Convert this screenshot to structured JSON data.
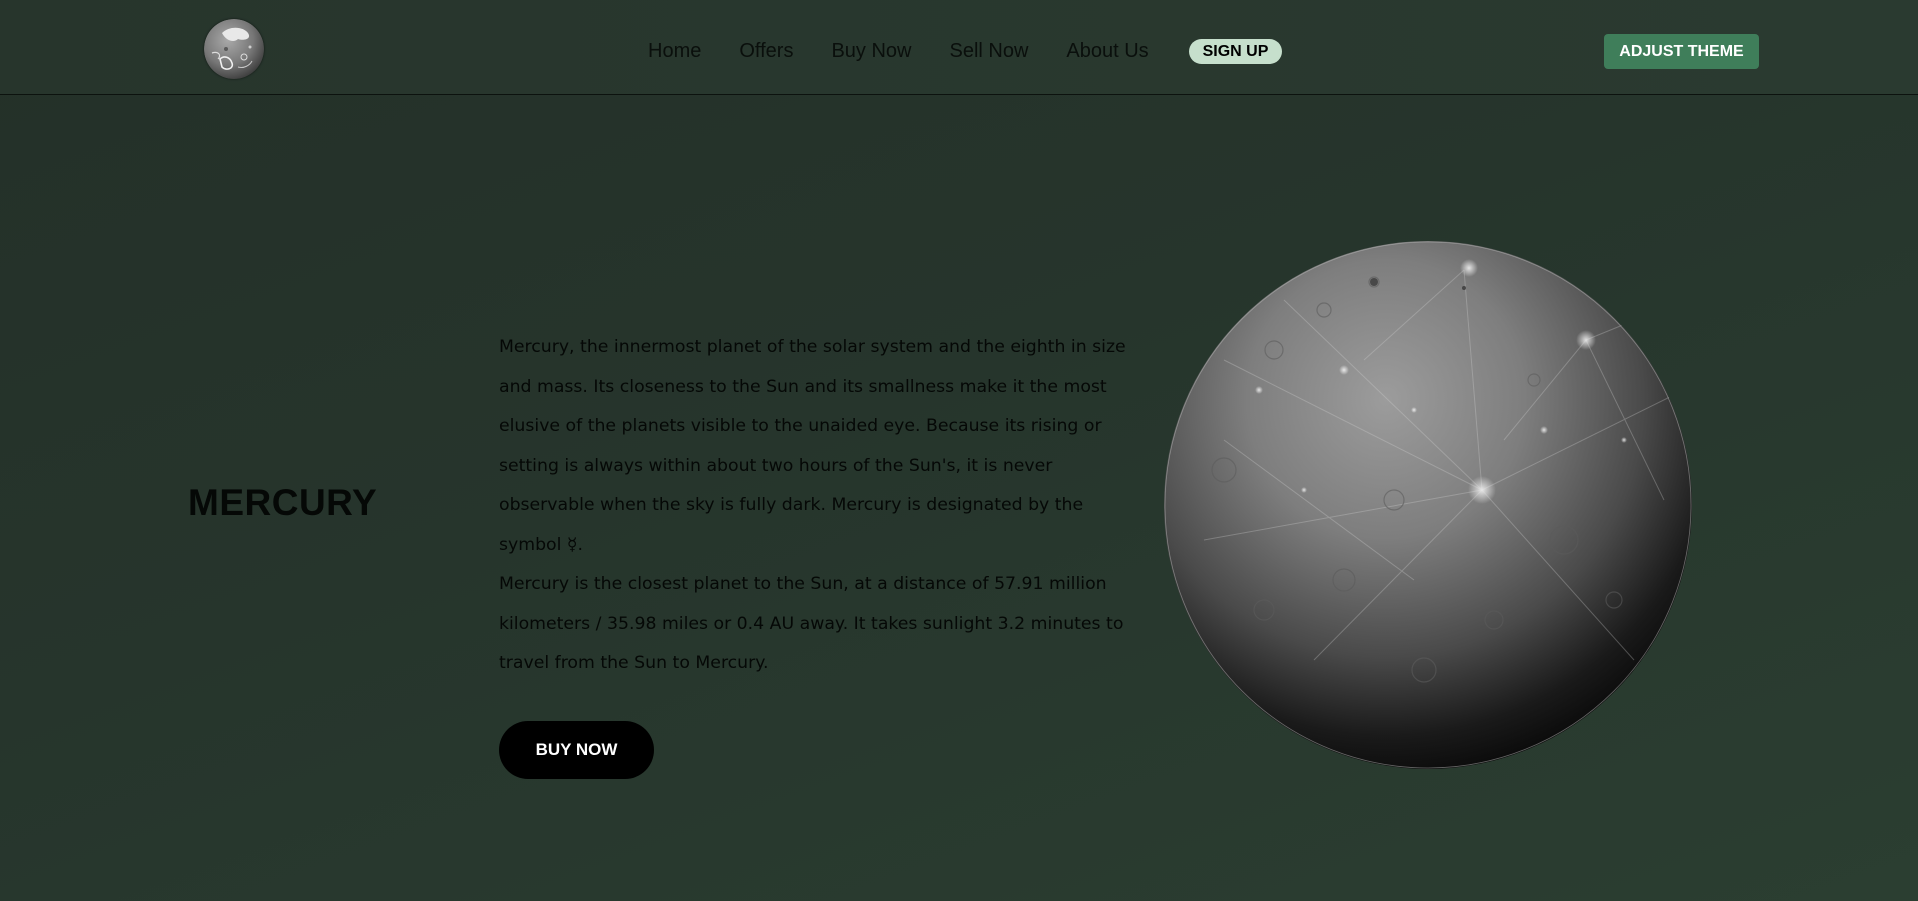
{
  "header": {
    "logo_icon": "planet-logo-icon",
    "nav": [
      {
        "label": "Home"
      },
      {
        "label": "Offers"
      },
      {
        "label": "Buy Now"
      },
      {
        "label": "Sell Now"
      },
      {
        "label": "About Us"
      }
    ],
    "signup_label": "SIGN UP",
    "theme_label": "ADJUST THEME"
  },
  "main": {
    "title": "MERCURY",
    "paragraphs": [
      "Mercury, the innermost planet of the solar system and the eighth in size and mass. Its closeness to the Sun and its smallness make it the most elusive of the planets visible to the unaided eye. Because its rising or setting is always within about two hours of the Sun's, it is never observable when the sky is fully dark. Mercury is designated by the symbol ☿.",
      "Mercury is the closest planet to the Sun, at a distance of 57.91 million kilometers / 35.98 miles or 0.4 AU away. It takes sunlight 3.2 minutes to travel from the Sun to Mercury."
    ],
    "buy_label": "BUY NOW",
    "planet_image": "mercury-planet-image"
  },
  "colors": {
    "background": "#26352c",
    "signup_bg": "#c6dfcc",
    "theme_btn_bg": "#3f7e5a",
    "buy_btn_bg": "#000000"
  }
}
